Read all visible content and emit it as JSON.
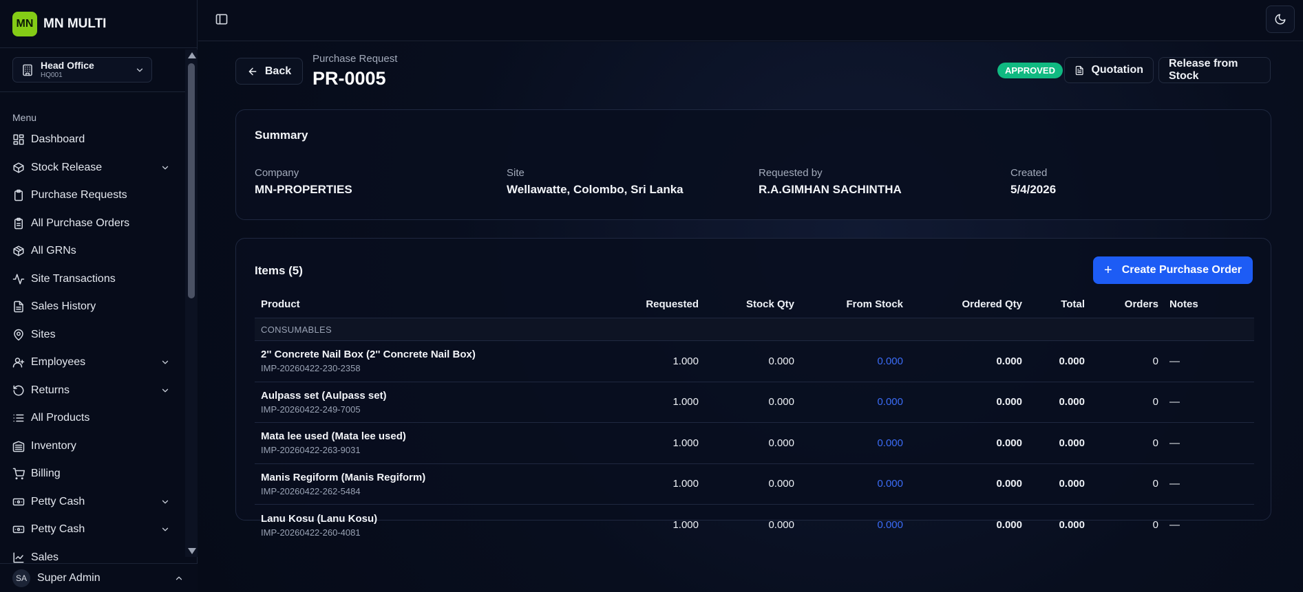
{
  "brand": {
    "logo": "MN",
    "name": "MN MULTI"
  },
  "branch": {
    "name": "Head Office",
    "code": "HQ001"
  },
  "sidebar": {
    "menu_label": "Menu",
    "items": [
      {
        "label": "Dashboard",
        "icon": "dashboard-icon",
        "expandable": false
      },
      {
        "label": "Stock Release",
        "icon": "box-icon",
        "expandable": true
      },
      {
        "label": "Purchase Requests",
        "icon": "clipboard-icon",
        "expandable": false
      },
      {
        "label": "All Purchase Orders",
        "icon": "clipboard-list-icon",
        "expandable": false
      },
      {
        "label": "All GRNs",
        "icon": "package-icon",
        "expandable": false
      },
      {
        "label": "Site Transactions",
        "icon": "activity-icon",
        "expandable": false
      },
      {
        "label": "Sales History",
        "icon": "file-text-icon",
        "expandable": false
      },
      {
        "label": "Sites",
        "icon": "map-pin-icon",
        "expandable": false
      },
      {
        "label": "Employees",
        "icon": "user-icon",
        "expandable": true
      },
      {
        "label": "Returns",
        "icon": "rotate-icon",
        "expandable": true
      },
      {
        "label": "All Products",
        "icon": "list-icon",
        "expandable": false
      },
      {
        "label": "Inventory",
        "icon": "warehouse-icon",
        "expandable": false
      },
      {
        "label": "Billing",
        "icon": "cart-icon",
        "expandable": false
      },
      {
        "label": "Petty Cash",
        "icon": "wallet-icon",
        "expandable": true
      },
      {
        "label": "Petty Cash",
        "icon": "wallet-icon",
        "expandable": true
      },
      {
        "label": "Sales",
        "icon": "chart-icon",
        "expandable": false
      }
    ]
  },
  "user": {
    "initials": "SA",
    "name": "Super Admin"
  },
  "header": {
    "back_label": "Back",
    "subtitle": "Purchase Request",
    "title": "PR-0005",
    "status": "APPROVED",
    "quotation_label": "Quotation",
    "release_label": "Release from Stock"
  },
  "summary": {
    "title": "Summary",
    "fields": [
      {
        "label": "Company",
        "value": "MN-PROPERTIES"
      },
      {
        "label": "Site",
        "value": "Wellawatte, Colombo, Sri Lanka"
      },
      {
        "label": "Requested by",
        "value": "R.A.GIMHAN SACHINTHA"
      },
      {
        "label": "Created",
        "value": "5/4/2026"
      }
    ]
  },
  "items": {
    "title": "Items (5)",
    "create_po_label": "Create Purchase Order",
    "columns": [
      "Product",
      "Requested",
      "Stock Qty",
      "From Stock",
      "Ordered Qty",
      "Total",
      "Orders",
      "Notes"
    ],
    "group": "CONSUMABLES",
    "rows": [
      {
        "name": "2'' Concrete Nail Box (2'' Concrete Nail Box)",
        "code": "IMP-20260422-230-2358",
        "requested": "1.000",
        "stock": "0.000",
        "from_stock": "0.000",
        "ordered": "0.000",
        "total": "0.000",
        "orders": "0",
        "notes": "—"
      },
      {
        "name": "Aulpass set (Aulpass set)",
        "code": "IMP-20260422-249-7005",
        "requested": "1.000",
        "stock": "0.000",
        "from_stock": "0.000",
        "ordered": "0.000",
        "total": "0.000",
        "orders": "0",
        "notes": "—"
      },
      {
        "name": "Mata lee used (Mata lee used)",
        "code": "IMP-20260422-263-9031",
        "requested": "1.000",
        "stock": "0.000",
        "from_stock": "0.000",
        "ordered": "0.000",
        "total": "0.000",
        "orders": "0",
        "notes": "—"
      },
      {
        "name": "Manis Regiform (Manis Regiform)",
        "code": "IMP-20260422-262-5484",
        "requested": "1.000",
        "stock": "0.000",
        "from_stock": "0.000",
        "ordered": "0.000",
        "total": "0.000",
        "orders": "0",
        "notes": "—"
      },
      {
        "name": "Lanu Kosu (Lanu Kosu)",
        "code": "IMP-20260422-260-4081",
        "requested": "1.000",
        "stock": "0.000",
        "from_stock": "0.000",
        "ordered": "0.000",
        "total": "0.000",
        "orders": "0",
        "notes": "—"
      }
    ]
  },
  "colors": {
    "accent": "#1d5cf5",
    "status": "#10b981",
    "brand": "#84cc16",
    "link": "#3b6cf6"
  }
}
